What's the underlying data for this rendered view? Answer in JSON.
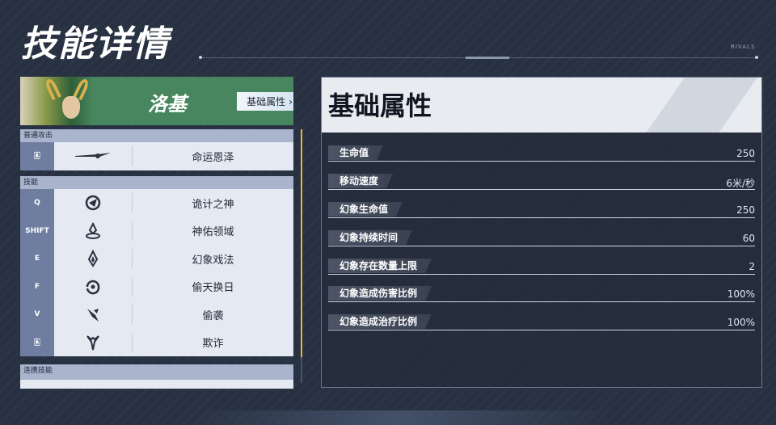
{
  "header": {
    "title": "技能详情",
    "brand": "RIVALS"
  },
  "hero": {
    "name": "洛基",
    "attr_button": "基础属性",
    "attr_button_icon": "chevron-right-icon"
  },
  "sections": {
    "basic_attack": "普通攻击",
    "skills": "技能",
    "team_up": "连携技能"
  },
  "basic_attack_rows": [
    {
      "key": "🀀",
      "icon": "dagger-icon",
      "name": "命运恩泽"
    }
  ],
  "skill_rows": [
    {
      "key": "Q",
      "icon": "serpent-crest-icon",
      "name": "诡计之神"
    },
    {
      "key": "SHIFT",
      "icon": "sanctuary-icon",
      "name": "神佑领域"
    },
    {
      "key": "E",
      "icon": "illusion-flame-icon",
      "name": "幻象戏法"
    },
    {
      "key": "F",
      "icon": "swap-spiral-icon",
      "name": "偷天换日"
    },
    {
      "key": "V",
      "icon": "backstab-icon",
      "name": "偷袭"
    },
    {
      "key": "🀀",
      "icon": "deceit-horns-icon",
      "name": "欺诈"
    }
  ],
  "right_panel": {
    "title": "基础属性",
    "stats": [
      {
        "label": "生命值",
        "value": "250"
      },
      {
        "label": "移动速度",
        "value": "6米/秒"
      },
      {
        "label": "幻象生命值",
        "value": "250"
      },
      {
        "label": "幻象持续时间",
        "value": "60"
      },
      {
        "label": "幻象存在数量上限",
        "value": "2"
      },
      {
        "label": "幻象造成伤害比例",
        "value": "100%"
      },
      {
        "label": "幻象造成治疗比例",
        "value": "100%"
      }
    ]
  },
  "colors": {
    "background": "#283142",
    "hero_banner": "#47865e",
    "accent_scrollbar": "#e7b838",
    "key_cell": "#6f7da1"
  }
}
